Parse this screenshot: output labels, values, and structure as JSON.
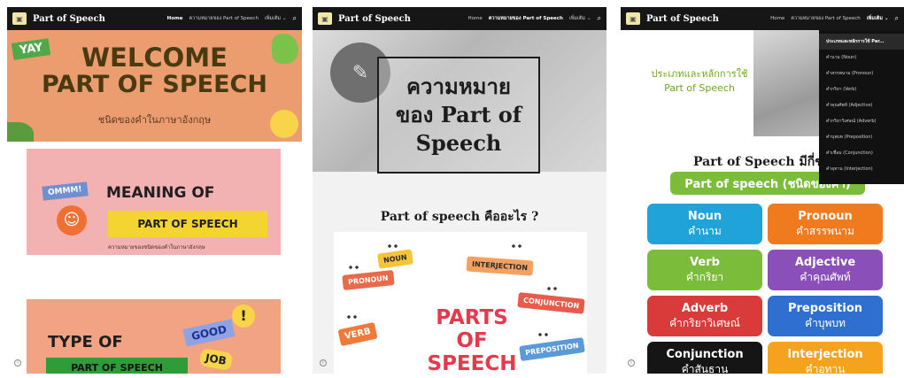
{
  "site_title": "Part of Speech",
  "nav": {
    "home": "Home",
    "meaning": "ความหมายของ Part of Speech",
    "more": "เพิ่มเติม ⌄",
    "search_icon": "search-icon"
  },
  "panel1": {
    "yay": "YAY",
    "title_line1": "WELCOME",
    "title_line2": "PART OF SPEECH",
    "subtitle": "ชนิดของคำในภาษาอังกฤษ",
    "meaning_sticker": "OMMM!",
    "meaning_title": "MEANING OF",
    "meaning_box": "PART OF SPEECH",
    "meaning_sub": "ความหมายของชนิดของคำในภาษาอังกฤษ",
    "type_title": "TYPE OF",
    "type_box": "PART OF SPEECH",
    "good": "GOOD",
    "job": "JOB",
    "bang": "!"
  },
  "panel2": {
    "hero_line1": "ความหมาย",
    "hero_line2": "ของ Part of",
    "hero_line3": "Speech",
    "question": "Part of speech คืออะไร ?",
    "tags": {
      "noun": "NOUN",
      "pronoun": "PRONOUN",
      "interjection": "INTERJECTION",
      "conjunction": "CONJUNCTION",
      "verb": "VERB",
      "preposition": "PREPOSITION"
    },
    "parts_line1": "PARTS",
    "parts_line2": "OF",
    "parts_line3": "SPEECH"
  },
  "panel3": {
    "lead_line1": "ประเภทและหลักการใช้",
    "lead_line2": "Part of Speech",
    "menu": [
      "ประเภทและหลักการใช้ Par...",
      "คำนาม (Noun)",
      "คำสรรพนาม (Pronoun)",
      "คำกริยา (Verb)",
      "คำคุณศัพท์ (Adjective)",
      "คำกริยาวิเศษณ์ (Adverb)",
      "คำบุพบท (Preposition)",
      "คำเชื่อม (Conjunction)",
      "คำอุทาน (Interjection)"
    ],
    "count_heading": "Part of Speech มีกี่ชนิ",
    "banner": "Part of speech (ชนิดของคำ)",
    "tiles": [
      {
        "en": "Noun",
        "th": "คำนาม",
        "color": "#1fa3d8"
      },
      {
        "en": "Pronoun",
        "th": "คำสรรพนาม",
        "color": "#f07a1e"
      },
      {
        "en": "Verb",
        "th": "คำกริยา",
        "color": "#7cbc3b"
      },
      {
        "en": "Adjective",
        "th": "คำคุณศัพท์",
        "color": "#8a4fb8"
      },
      {
        "en": "Adverb",
        "th": "คำกริยาวิเศษณ์",
        "color": "#d93a3a"
      },
      {
        "en": "Preposition",
        "th": "คำบุพบท",
        "color": "#2f6fd0"
      },
      {
        "en": "Conjunction",
        "th": "คำสันธาน",
        "color": "#151515"
      },
      {
        "en": "Interjection",
        "th": "คำอุทาน",
        "color": "#f5a21e"
      }
    ]
  }
}
